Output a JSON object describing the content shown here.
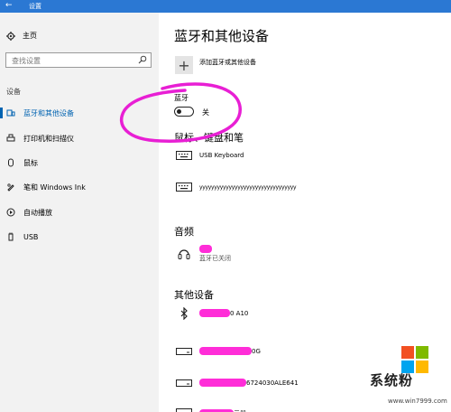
{
  "window": {
    "title": "设置",
    "back_glyph": "←"
  },
  "sidebar": {
    "home_label": "主页",
    "search_placeholder": "查找设置",
    "section_label": "设备",
    "items": [
      {
        "label": "蓝牙和其他设备",
        "icon": "bluetooth-devices-icon",
        "active": true
      },
      {
        "label": "打印机和扫描仪",
        "icon": "printer-icon"
      },
      {
        "label": "鼠标",
        "icon": "mouse-icon"
      },
      {
        "label": "笔和 Windows Ink",
        "icon": "pen-icon"
      },
      {
        "label": "自动播放",
        "icon": "autoplay-icon"
      },
      {
        "label": "USB",
        "icon": "usb-icon"
      }
    ]
  },
  "main": {
    "title": "蓝牙和其他设备",
    "add_device_label": "添加蓝牙或其他设备",
    "bluetooth": {
      "label": "蓝牙",
      "toggle_state": "关"
    },
    "mouse_keyboard_pen": {
      "heading": "鼠标、键盘和笔",
      "devices": [
        {
          "name": "USB Keyboard",
          "icon": "keyboard-icon"
        },
        {
          "name": "yyyyyyyyyyyyyyyyyyyyyyyyyyyyyyyyy",
          "icon": "keyboard-icon"
        }
      ]
    },
    "audio": {
      "heading": "音频",
      "devices": [
        {
          "status": "蓝牙已关闭",
          "icon": "headset-icon"
        }
      ]
    },
    "other_devices": {
      "heading": "其他设备",
      "devices": [
        {
          "name_visible": "0 A10",
          "icon": "bluetooth-icon"
        },
        {
          "name_visible": "0G",
          "icon": "drive-icon"
        },
        {
          "name_visible": "6724030ALE641",
          "icon": "drive-icon"
        },
        {
          "name_visible": "示器",
          "icon": "monitor-icon"
        }
      ]
    }
  },
  "watermark": {
    "brand": "系统粉",
    "url": "www.win7999.com"
  },
  "colors": {
    "accent": "#0063b1",
    "titlebar": "#2b78d3",
    "redaction": "#ff22d6",
    "sidebar_bg": "#f2f2f2"
  }
}
